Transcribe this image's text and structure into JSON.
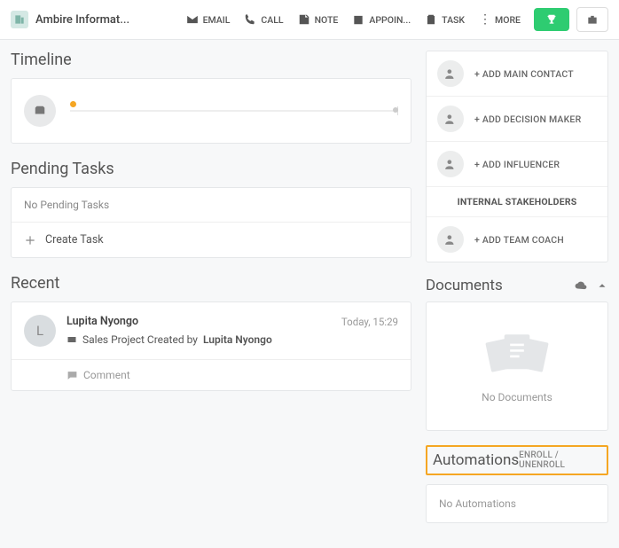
{
  "header": {
    "company_name": "Ambire Informat...",
    "actions": {
      "email": "EMAIL",
      "call": "CALL",
      "note": "NOTE",
      "appointment": "APPOIN...",
      "task": "TASK",
      "more": "MORE"
    }
  },
  "timeline": {
    "title": "Timeline"
  },
  "pending": {
    "title": "Pending Tasks",
    "empty": "No Pending Tasks",
    "create": "Create Task"
  },
  "recent": {
    "title": "Recent",
    "avatar_initial": "L",
    "actor": "Lupita Nyongo",
    "time": "Today, 15:29",
    "event_prefix": "Sales Project Created by ",
    "event_bold": "Lupita Nyongo",
    "comment": "Comment"
  },
  "side_contacts": {
    "main": "+ ADD MAIN CONTACT",
    "decision": "+ ADD DECISION MAKER",
    "influencer": "+ ADD INFLUENCER",
    "internal_title": "INTERNAL STAKEHOLDERS",
    "team_coach": "+ ADD TEAM COACH"
  },
  "documents": {
    "title": "Documents",
    "empty": "No Documents"
  },
  "automations": {
    "title": "Automations",
    "link": "ENROLL / UNENROLL",
    "empty": "No Automations"
  }
}
